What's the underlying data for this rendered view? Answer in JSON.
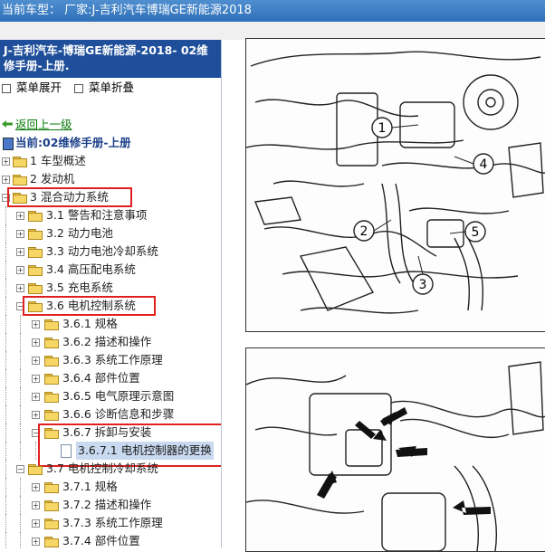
{
  "window": {
    "title": "当前车型： 厂家:J-吉利汽车博瑞GE新能源2018"
  },
  "sidebar": {
    "book_title": "J-吉利汽车-博瑞GE新能源-2018- 02维修手册-上册.",
    "expand_label": "菜单展开",
    "collapse_label": "菜单折叠",
    "back_label": "返回上一级",
    "current_label": "当前:02维修手册-上册",
    "items": [
      {
        "label": "1 车型概述"
      },
      {
        "label": "2 发动机"
      },
      {
        "label": "3 混合动力系统"
      },
      {
        "label": "3.1 警告和注意事项"
      },
      {
        "label": "3.2 动力电池"
      },
      {
        "label": "3.3 动力电池冷却系统"
      },
      {
        "label": "3.4 高压配电系统"
      },
      {
        "label": "3.5 充电系统"
      },
      {
        "label": "3.6 电机控制系统"
      },
      {
        "label": "3.6.1 规格"
      },
      {
        "label": "3.6.2 描述和操作"
      },
      {
        "label": "3.6.3 系统工作原理"
      },
      {
        "label": "3.6.4 部件位置"
      },
      {
        "label": "3.6.5 电气原理示意图"
      },
      {
        "label": "3.6.6 诊断信息和步骤"
      },
      {
        "label": "3.6.7 拆卸与安装"
      },
      {
        "label": "3.6.7.1 电机控制器的更换"
      },
      {
        "label": "3.7 电机控制冷却系统"
      },
      {
        "label": "3.7.1 规格"
      },
      {
        "label": "3.7.2 描述和操作"
      },
      {
        "label": "3.7.3 系统工作原理"
      },
      {
        "label": "3.7.4 部件位置"
      }
    ]
  },
  "figure1": {
    "callouts": [
      "1",
      "2",
      "3",
      "4",
      "5"
    ]
  },
  "colors": {
    "titlebar": "#2f6fb8",
    "book_header": "#1f4f9a",
    "highlight_box": "#e02020",
    "selected": "#c9d9ef"
  }
}
